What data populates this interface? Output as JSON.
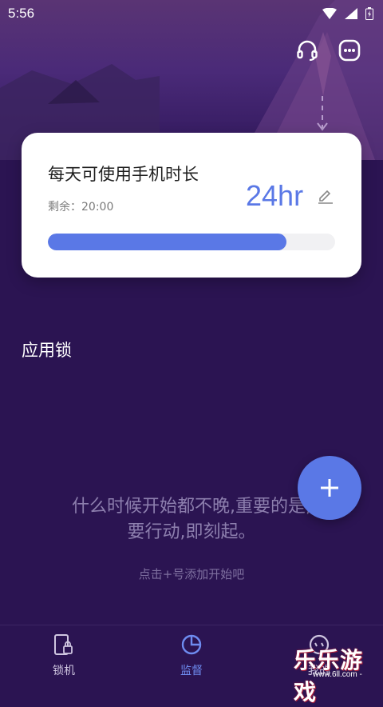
{
  "status_bar": {
    "time": "5:56"
  },
  "header": {
    "support_icon": "headset-icon",
    "more_icon": "more-dots-icon"
  },
  "usage_card": {
    "title": "每天可使用手机时长",
    "remaining": "剩余：20:00",
    "hours": "24hr",
    "progress": 0.83
  },
  "app_lock": {
    "title": "应用锁",
    "empty_quote": "什么时候开始都不晚,重要的是,要行动,即刻起。",
    "empty_hint": "点击+号添加开始吧"
  },
  "fab": {
    "icon": "plus-icon"
  },
  "bottom_nav": {
    "items": [
      {
        "label": "锁机",
        "icon": "phone-lock-icon"
      },
      {
        "label": "监督",
        "icon": "pie-chart-icon"
      },
      {
        "label": "我的",
        "icon": "profile-icon"
      }
    ]
  },
  "watermark": {
    "text": "乐乐游戏",
    "url": "- www.6ll.com -"
  },
  "colors": {
    "accent": "#5a78e6",
    "background": "#2b1452",
    "card": "#ffffff"
  }
}
